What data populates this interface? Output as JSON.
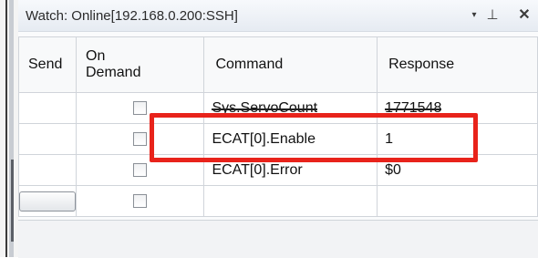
{
  "window": {
    "title": "Watch: Online[192.168.0.200:SSH]",
    "dropdown_glyph": "▾",
    "pin_glyph": "⊥",
    "close_glyph": "✕"
  },
  "columns": {
    "send": "Send",
    "on_demand_line1": "On",
    "on_demand_line2": "Demand",
    "command": "Command",
    "response": "Response"
  },
  "rows": [
    {
      "command": "Sys.ServoCount",
      "response": "1771548",
      "on_demand": false,
      "has_send_button": false
    },
    {
      "command": "ECAT[0].Enable",
      "response": "1",
      "on_demand": false,
      "has_send_button": false
    },
    {
      "command": "ECAT[0].Error",
      "response": "$0",
      "on_demand": false,
      "has_send_button": false
    },
    {
      "command": "",
      "response": "",
      "on_demand": false,
      "has_send_button": true
    }
  ],
  "annotation": {
    "highlight_color": "#e8231b"
  }
}
